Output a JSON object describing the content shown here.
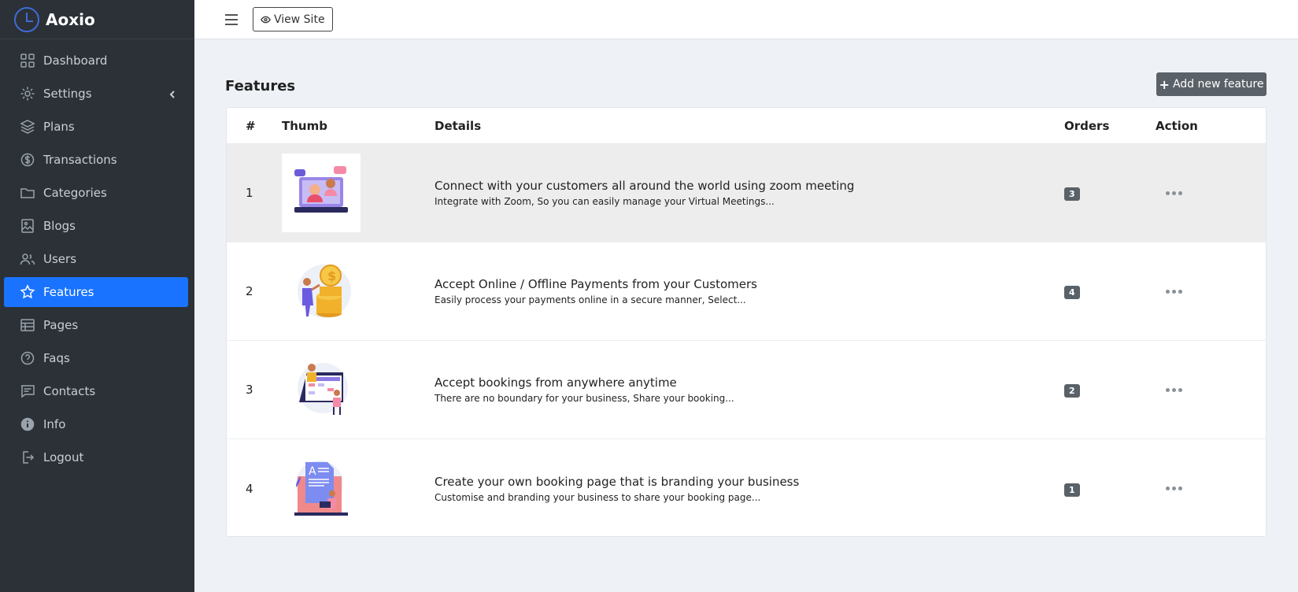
{
  "app": {
    "brand": "Aoxio"
  },
  "sidebar": {
    "items": [
      {
        "label": "Dashboard",
        "icon": "grid-icon"
      },
      {
        "label": "Settings",
        "icon": "gear-icon"
      },
      {
        "label": "Plans",
        "icon": "layers-icon"
      },
      {
        "label": "Transactions",
        "icon": "dollar-circle-icon"
      },
      {
        "label": "Categories",
        "icon": "folder-icon"
      },
      {
        "label": "Blogs",
        "icon": "image-icon"
      },
      {
        "label": "Users",
        "icon": "users-icon"
      },
      {
        "label": "Features",
        "icon": "star-icon",
        "active": true
      },
      {
        "label": "Pages",
        "icon": "table-icon"
      },
      {
        "label": "Faqs",
        "icon": "question-icon"
      },
      {
        "label": "Contacts",
        "icon": "message-icon"
      },
      {
        "label": "Info",
        "icon": "info-icon"
      },
      {
        "label": "Logout",
        "icon": "logout-icon"
      }
    ]
  },
  "topbar": {
    "view_site_label": "View Site"
  },
  "main": {
    "title": "Features",
    "add_button_label": "Add new feature",
    "table": {
      "headers": {
        "num": "#",
        "thumb": "Thumb",
        "details": "Details",
        "orders": "Orders",
        "action": "Action"
      },
      "rows": [
        {
          "num": "1",
          "title": "Connect with your customers all around the world using zoom meeting",
          "desc": "Integrate with Zoom, So you can easily manage your Virtual Meetings...",
          "orders": "3"
        },
        {
          "num": "2",
          "title": "Accept Online / Offline Payments from your Customers",
          "desc": "Easily process your payments online in a secure manner, Select...",
          "orders": "4"
        },
        {
          "num": "3",
          "title": "Accept bookings from anywhere anytime",
          "desc": "There are no boundary for your business, Share your booking...",
          "orders": "2"
        },
        {
          "num": "4",
          "title": "Create your own booking page that is branding your business",
          "desc": "Customise and branding your business to share your booking page...",
          "orders": "1"
        }
      ]
    }
  },
  "colors": {
    "sidebar_bg": "#2b3136",
    "active_bg": "#1a73ff",
    "button_bg": "#5a6168",
    "page_bg": "#eef1f5"
  }
}
